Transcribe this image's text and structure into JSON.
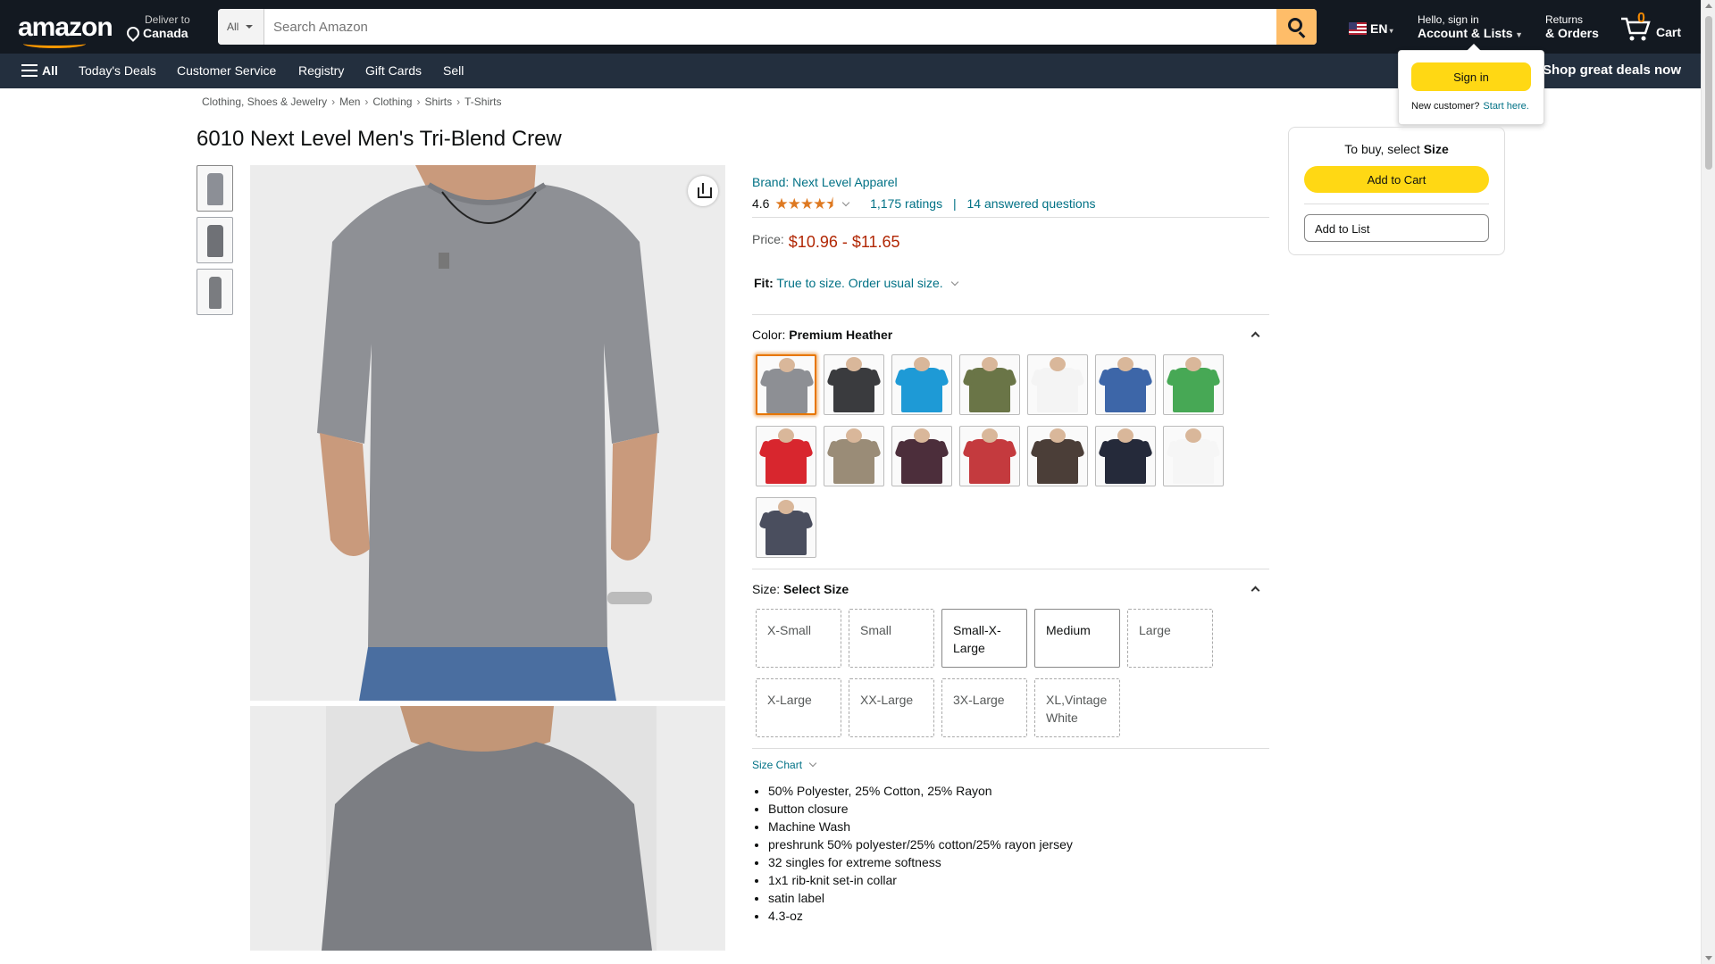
{
  "header": {
    "logo": "amazon",
    "deliver_line1": "Deliver to",
    "deliver_line2": "Canada",
    "search_category": "All",
    "search_placeholder": "Search Amazon",
    "language": "EN",
    "account_line1": "Hello, sign in",
    "account_line2": "Account & Lists",
    "returns_line1": "Returns",
    "returns_line2": "& Orders",
    "cart_count": "0",
    "cart_label": "Cart"
  },
  "subnav": {
    "all_label": "All",
    "items": [
      "Today's Deals",
      "Customer Service",
      "Registry",
      "Gift Cards",
      "Sell"
    ],
    "banner": "Shop great deals now"
  },
  "signin_flyout": {
    "button": "Sign in",
    "new_customer": "New customer?",
    "start_here": "Start here."
  },
  "breadcrumb": [
    "Clothing, Shoes & Jewelry",
    "Men",
    "Clothing",
    "Shirts",
    "T-Shirts"
  ],
  "product": {
    "title": "6010 Next Level Men's Tri-Blend Crew",
    "brand": "Brand: Next Level Apparel",
    "rating": "4.6",
    "stars": "★★★★⯨",
    "ratings_count": "1,175 ratings",
    "separator": "|",
    "answered": "14 answered questions",
    "price_label": "Price:",
    "price_value": "$10.96 - $11.65",
    "fit_label": "Fit:",
    "fit_value": "True to size. Order usual size.",
    "color_label": "Color:",
    "color_value": "Premium Heather",
    "colors": [
      "#8d8f94",
      "#3a3b3e",
      "#1e9ad6",
      "#6a7547",
      "#f4f4f4",
      "#3d66a8",
      "#47a855",
      "#d8262e",
      "#9a8c77",
      "#4c2e3b",
      "#c43a3e",
      "#4b3e38",
      "#252a3a",
      "#f6f6f6",
      "#4a4e5e"
    ],
    "size_label": "Size:",
    "size_value": "Select Size",
    "sizes": [
      "X-Small",
      "Small",
      "Small-X-Large",
      "Medium",
      "Large",
      "X-Large",
      "XX-Large",
      "3X-Large",
      "XL,Vintage White"
    ],
    "size_chart": "Size Chart",
    "bullets": [
      "50% Polyester, 25% Cotton, 25% Rayon",
      "Button closure",
      "Machine Wash",
      "preshrunk 50% polyester/25% cotton/25% rayon jersey",
      "32 singles for extreme softness",
      "1x1 rib-knit set-in collar",
      "satin label",
      "4.3-oz"
    ]
  },
  "buybox": {
    "lead": "To buy, select",
    "lead_bold": "Size",
    "add_to_cart": "Add to Cart",
    "add_to_list": "Add to List"
  }
}
